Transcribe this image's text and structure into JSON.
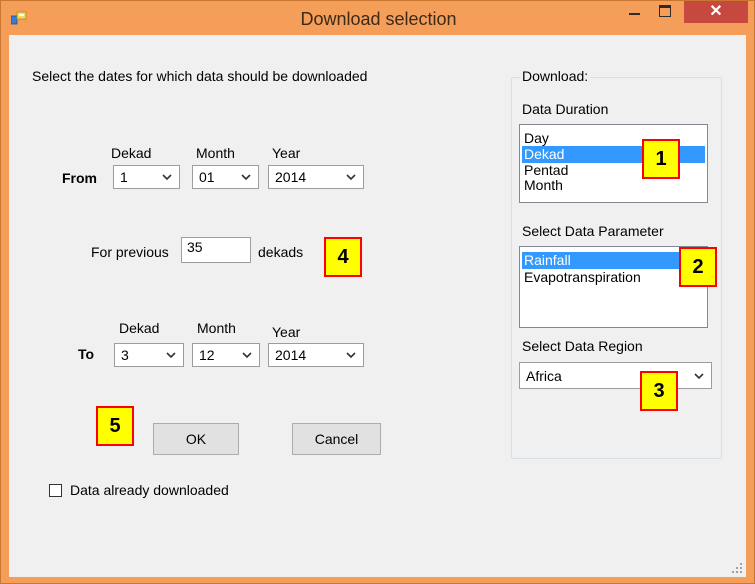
{
  "window": {
    "title": "Download selection",
    "close_glyph": "✕",
    "colors": {
      "frame": "#f49e5a",
      "close": "#c7483f",
      "selection": "#3399ff",
      "callout_fill": "#ffff00",
      "callout_border": "#ff0000"
    }
  },
  "instruction": "Select the dates for which data should be downloaded",
  "from": {
    "label": "From",
    "dekad_label": "Dekad",
    "month_label": "Month",
    "year_label": "Year",
    "dekad": "1",
    "month": "01",
    "year": "2014"
  },
  "previous": {
    "prefix": "For previous",
    "value": "35",
    "suffix": "dekads"
  },
  "to": {
    "label": "To",
    "dekad_label": "Dekad",
    "month_label": "Month",
    "year_label": "Year",
    "dekad": "3",
    "month": "12",
    "year": "2014"
  },
  "buttons": {
    "ok": "OK",
    "cancel": "Cancel"
  },
  "checkbox": {
    "label": "Data already downloaded",
    "checked": false
  },
  "download_group": {
    "title": "Download:",
    "duration_label": "Data Duration",
    "duration_items": [
      "Day",
      "Dekad",
      "Pentad",
      "Month"
    ],
    "duration_selected": "Dekad",
    "parameter_label": "Select Data Parameter",
    "parameter_items": [
      "Rainfall",
      "Evapotranspiration"
    ],
    "parameter_selected": "Rainfall",
    "region_label": "Select Data Region",
    "region_value": "Africa"
  },
  "callouts": [
    "1",
    "2",
    "3",
    "4",
    "5"
  ],
  "icons": [
    "app-icon",
    "minimize-icon",
    "maximize-icon",
    "close-icon",
    "chevron-down-icon",
    "resize-grip-icon"
  ]
}
